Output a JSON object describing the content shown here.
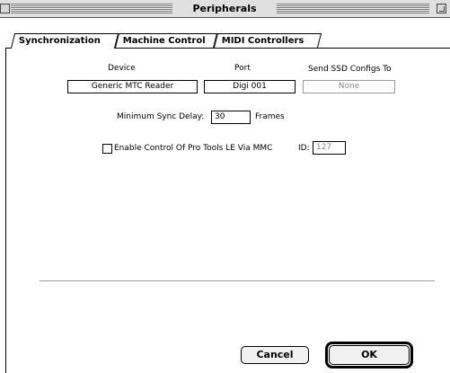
{
  "window": {
    "title": "Peripherals"
  },
  "tabs": [
    {
      "label": "Synchronization",
      "active": true
    },
    {
      "label": "Machine Control",
      "active": false
    },
    {
      "label": "MIDI Controllers",
      "active": false
    }
  ],
  "sync": {
    "device_header": "Device",
    "device_value": "Generic MTC Reader",
    "port_header": "Port",
    "port_value": "Digi 001",
    "ssd_header": "Send SSD Configs To",
    "ssd_value": "None",
    "min_delay_label": "Minimum Sync Delay:",
    "min_delay_value": "30",
    "frames_label": "Frames",
    "mmc_label": "Enable Control Of Pro Tools LE Via MMC",
    "mmc_checked": false,
    "id_label": "ID:",
    "id_value": "127"
  },
  "buttons": {
    "cancel": "Cancel",
    "ok": "OK"
  }
}
